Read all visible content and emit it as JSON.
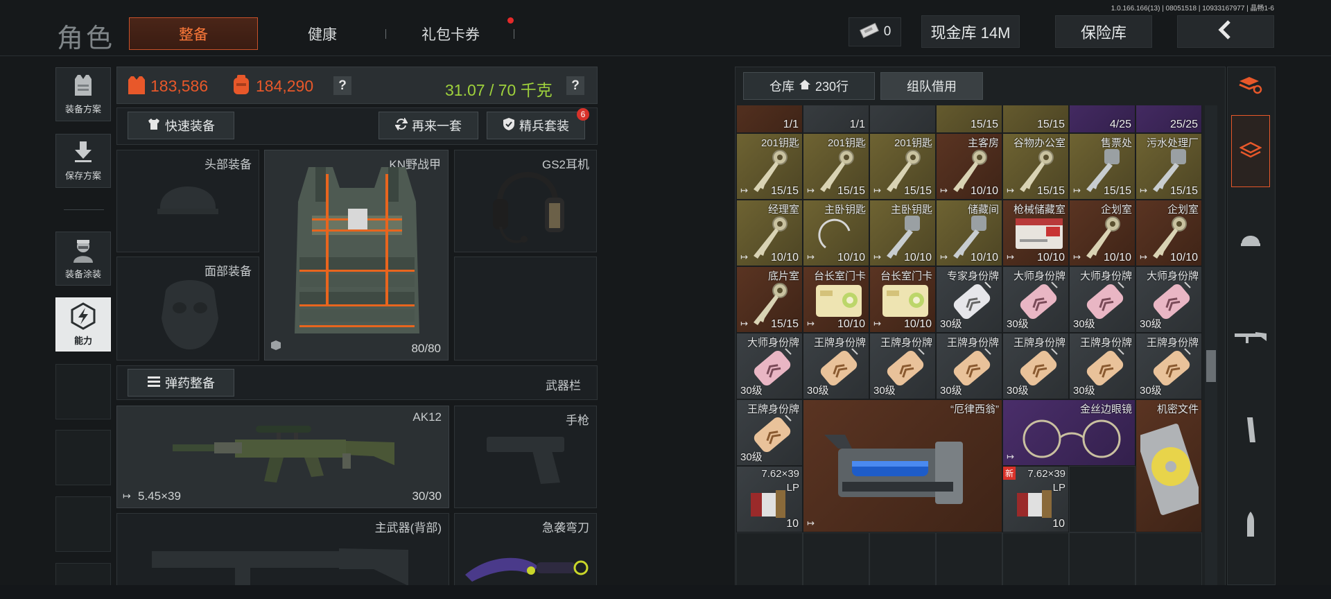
{
  "version_info": "1.0.166.166(13) | 08051518 | 10933167977 | 晶畅1-6",
  "header": {
    "title": "角色",
    "tabs": [
      {
        "label": "整备",
        "active": true
      },
      {
        "label": "健康",
        "active": false
      },
      {
        "label": "礼包卡券",
        "active": false
      }
    ],
    "ticket_count": "0",
    "cash_label": "现金库 14M",
    "vault_label": "保险库",
    "back_icon": "chevron-left-icon"
  },
  "left_sidebar": {
    "items": [
      {
        "label": "装备方案",
        "icon": "vest-icon"
      },
      {
        "label": "保存方案",
        "icon": "download-icon"
      },
      {
        "label": "装备涂装",
        "icon": "soldier-icon"
      },
      {
        "label": "能力",
        "icon": "lightning-icon"
      }
    ]
  },
  "stats": {
    "armor_value": "183,586",
    "bag_value": "184,290",
    "weight": "31.07 / 70 千克",
    "help": "?"
  },
  "actions": {
    "quick_equip": "快速装备",
    "again": "再来一套",
    "elite": "精兵套装",
    "elite_badge": "6",
    "ammo": "弹药整备",
    "weapon_bar": "武器栏"
  },
  "slots": {
    "head": "头部装备",
    "face": "面部装备",
    "vest": "KN野战甲",
    "vest_durability": "80/80",
    "headset": "GS2耳机",
    "main_weapon": "AK12",
    "main_ammo": "5.45×39",
    "main_mag": "30/30",
    "pistol": "手枪",
    "back_weapon": "主武器(背部)",
    "melee": "急袭弯刀"
  },
  "warehouse": {
    "tab_storage": "仓库",
    "rows_label": "230行",
    "tab_team": "组队借用",
    "top_row": [
      {
        "count": "1/1",
        "bg": "c-brown"
      },
      {
        "count": "1/1",
        "bg": "c-gray"
      },
      {
        "count": "",
        "bg": "c-gray"
      },
      {
        "count": "15/15",
        "bg": "c-gold"
      },
      {
        "count": "15/15",
        "bg": "c-gold"
      },
      {
        "count": "4/25",
        "bg": "c-purple"
      },
      {
        "count": "25/25",
        "bg": "c-purple"
      }
    ],
    "rows": [
      [
        {
          "name": "201钥匙",
          "count": "15/15",
          "bg": "c-gold",
          "type": "key"
        },
        {
          "name": "201钥匙",
          "count": "15/15",
          "bg": "c-gold",
          "type": "key"
        },
        {
          "name": "201钥匙",
          "count": "15/15",
          "bg": "c-gold",
          "type": "key"
        },
        {
          "name": "主客房",
          "count": "10/10",
          "bg": "c-brown",
          "type": "key"
        },
        {
          "name": "谷物办公室",
          "count": "15/15",
          "bg": "c-gold",
          "type": "key"
        },
        {
          "name": "售票处",
          "count": "15/15",
          "bg": "c-gold",
          "type": "keygray"
        },
        {
          "name": "污水处理厂",
          "count": "15/15",
          "bg": "c-gold",
          "type": "keygray"
        }
      ],
      [
        {
          "name": "经理室",
          "count": "10/10",
          "bg": "c-gold",
          "type": "key"
        },
        {
          "name": "主卧钥匙",
          "count": "10/10",
          "bg": "c-gold",
          "type": "ring"
        },
        {
          "name": "主卧钥匙",
          "count": "10/10",
          "bg": "c-gold",
          "type": "keygray"
        },
        {
          "name": "储藏间",
          "count": "10/10",
          "bg": "c-gold",
          "type": "keygray"
        },
        {
          "name": "枪械储藏室",
          "count": "10/10",
          "bg": "c-brown",
          "type": "card"
        },
        {
          "name": "企划室",
          "count": "10/10",
          "bg": "c-brown",
          "type": "key"
        },
        {
          "name": "企划室",
          "count": "10/10",
          "bg": "c-brown",
          "type": "key"
        }
      ],
      [
        {
          "name": "底片室",
          "count": "15/15",
          "bg": "c-brown",
          "type": "key"
        },
        {
          "name": "台长室门卡",
          "count": "10/10",
          "bg": "c-brown",
          "type": "keycard"
        },
        {
          "name": "台长室门卡",
          "count": "10/10",
          "bg": "c-brown",
          "type": "keycard"
        },
        {
          "name": "专家身份牌",
          "level": "30级",
          "bg": "c-gray",
          "type": "tag-white"
        },
        {
          "name": "大师身份牌",
          "level": "30级",
          "bg": "c-gray",
          "type": "tag-pink"
        },
        {
          "name": "大师身份牌",
          "level": "30级",
          "bg": "c-gray",
          "type": "tag-pink"
        },
        {
          "name": "大师身份牌",
          "level": "30级",
          "bg": "c-gray",
          "type": "tag-pink"
        }
      ],
      [
        {
          "name": "大师身份牌",
          "level": "30级",
          "bg": "c-gray",
          "type": "tag-pink"
        },
        {
          "name": "王牌身份牌",
          "level": "30级",
          "bg": "c-gray",
          "type": "tag-gold"
        },
        {
          "name": "王牌身份牌",
          "level": "30级",
          "bg": "c-gray",
          "type": "tag-gold"
        },
        {
          "name": "王牌身份牌",
          "level": "30级",
          "bg": "c-gray",
          "type": "tag-gold"
        },
        {
          "name": "王牌身份牌",
          "level": "30级",
          "bg": "c-gray",
          "type": "tag-gold"
        },
        {
          "name": "王牌身份牌",
          "level": "30级",
          "bg": "c-gray",
          "type": "tag-gold"
        },
        {
          "name": "王牌身份牌",
          "level": "30级",
          "bg": "c-gray",
          "type": "tag-gold"
        }
      ]
    ],
    "bottom": {
      "tag_name": "王牌身份牌",
      "tag_level": "30级",
      "big_item": "“厄律西翁”",
      "glasses": "金丝边眼镜",
      "docs": "机密文件",
      "ammo1_name": "7.62×39",
      "ammo1_grade": "LP",
      "ammo1_count": "10",
      "ammo2_name": "7.62×39",
      "ammo2_grade": "LP",
      "ammo2_count": "10",
      "new_badge": "新"
    }
  },
  "right_filters": [
    "refresh-icon",
    "layers-icon",
    "helmet-icon",
    "rifle-icon",
    "magazine-icon",
    "bullet-icon"
  ],
  "colors": {
    "accent": "#e8582a",
    "green": "#9fd23c",
    "panel": "#23282b"
  }
}
